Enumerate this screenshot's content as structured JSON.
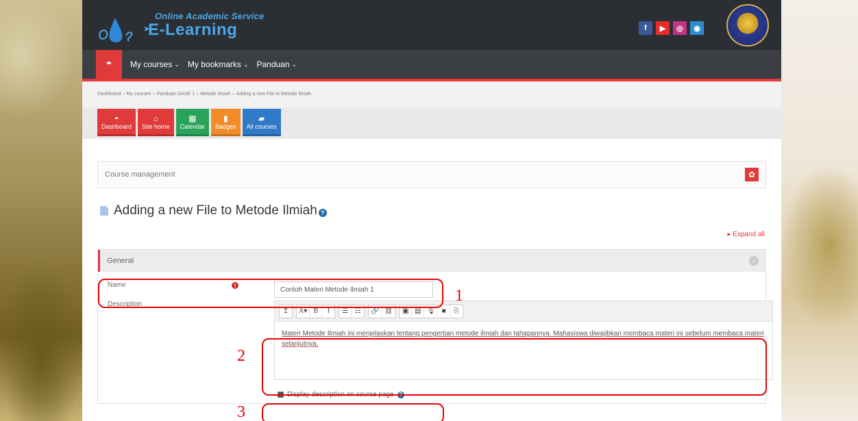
{
  "header": {
    "tagline": "Online Academic Service",
    "title": "E-Learning",
    "social": [
      {
        "icon": "facebook-icon",
        "glyph": "f",
        "color": "#3b5998"
      },
      {
        "icon": "youtube-icon",
        "glyph": "▶",
        "color": "#e52d27"
      },
      {
        "icon": "instagram-icon",
        "glyph": "◎",
        "color": "#c13584"
      },
      {
        "icon": "web-icon",
        "glyph": "◉",
        "color": "#2d8ccf"
      }
    ]
  },
  "nav": {
    "home_icon": "dashboard-icon",
    "items": [
      "My courses",
      "My bookmarks",
      "Panduan"
    ]
  },
  "breadcrumb": [
    "Dashboard",
    "My courses",
    "Panduan OASE 1",
    "Metode Ilmiah",
    "Adding a new File to Metode Ilmiah"
  ],
  "tiles": [
    {
      "label": "Dashboard",
      "icon": "dashboard-icon",
      "glyph": "◓",
      "color": "#e03a3a"
    },
    {
      "label": "Site home",
      "icon": "home-icon",
      "glyph": "⌂",
      "color": "#e03a3a"
    },
    {
      "label": "Calendar",
      "icon": "calendar-icon",
      "glyph": "▦",
      "color": "#2aa35a"
    },
    {
      "label": "Badges",
      "icon": "badge-icon",
      "glyph": "▮",
      "color": "#f28c28"
    },
    {
      "label": "All courses",
      "icon": "courses-icon",
      "glyph": "▰",
      "color": "#2f79c7"
    }
  ],
  "course_management": "Course management",
  "page_title": "Adding a new File to Metode Ilmiah",
  "expand_all": "Expand all",
  "general": {
    "heading": "General",
    "name_label": "Name",
    "name_value": "Contoh Materi Metode Ilmiah 1",
    "description_label": "Description",
    "description_text": "Materi Metode Ilmiah ini menjelaskan tentang pengertian metode ilmiah dan tahapannya. Mahasiswa diwajibkan membaca materi ini sebelum membaca materi selanjutnya.",
    "display_description": "Display description on course page"
  },
  "toolbar": {
    "groups": [
      [
        "↥"
      ],
      [
        "A▾",
        "B",
        "I"
      ],
      [
        "☰",
        "☷"
      ],
      [
        "🔗",
        "⛓"
      ],
      [
        "▣",
        "▤",
        "🎙",
        "■",
        "⎘"
      ]
    ]
  },
  "annotations": [
    "1",
    "2",
    "3"
  ]
}
